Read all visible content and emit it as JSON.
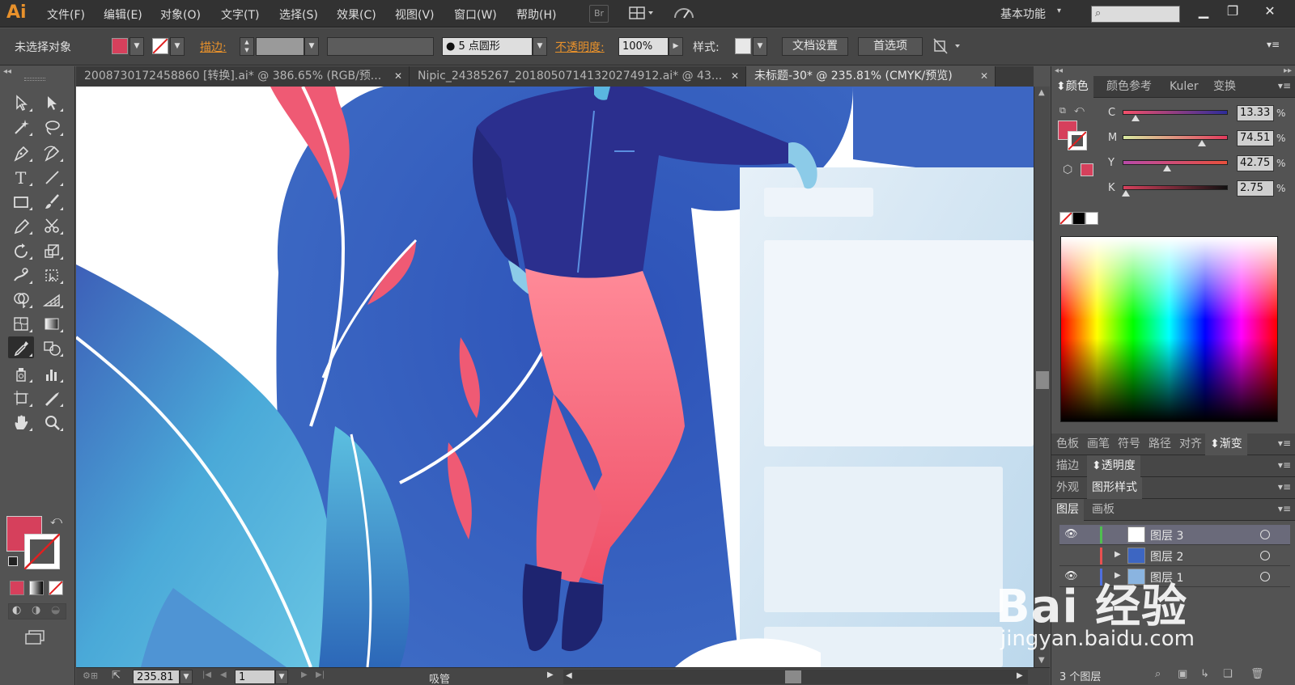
{
  "app": {
    "logo": "Ai"
  },
  "menu": [
    "文件(F)",
    "编辑(E)",
    "对象(O)",
    "文字(T)",
    "选择(S)",
    "效果(C)",
    "视图(V)",
    "窗口(W)",
    "帮助(H)"
  ],
  "menubar_icons": {
    "bridge": "Br"
  },
  "workspace": {
    "label": "基本功能",
    "search_placeholder": ""
  },
  "control_bar": {
    "selection_status": "未选择对象",
    "stroke_label": "描边",
    "brush_label": "5 点圆形",
    "opacity_label": "不透明度",
    "opacity_value": "100%",
    "style_label": "样式",
    "doc_setup_button": "文档设置",
    "preferences_button": "首选项",
    "fill_color": "#d6405c"
  },
  "document_tabs": [
    {
      "title": "2008730172458860 [转换].ai* @ 386.65% (RGB/预...",
      "active": false
    },
    {
      "title": "Nipic_24385267_20180507141320274912.ai* @ 43...",
      "active": false
    },
    {
      "title": "未标题-30* @ 235.81% (CMYK/预览)",
      "active": true
    }
  ],
  "tools": [
    "selection-tool-icon",
    "direct-selection-tool-icon",
    "magic-wand-tool-icon",
    "lasso-tool-icon",
    "pen-tool-icon",
    "curvature-pen-tool-icon",
    "type-tool-icon",
    "line-segment-tool-icon",
    "rectangle-tool-icon",
    "paintbrush-tool-icon",
    "pencil-tool-icon",
    "scissors-tool-icon",
    "rotate-tool-icon",
    "scale-tool-icon",
    "warp-tool-icon",
    "free-transform-tool-icon",
    "shape-builder-tool-icon",
    "perspective-grid-tool-icon",
    "mesh-tool-icon",
    "gradient-tool-icon",
    "eyedropper-tool-icon",
    "blend-tool-icon",
    "symbol-sprayer-tool-icon",
    "column-graph-tool-icon",
    "artboard-tool-icon",
    "slice-tool-icon",
    "hand-tool-icon",
    "zoom-tool-icon"
  ],
  "status_bar": {
    "zoom": "235.81",
    "artboard": "1",
    "current_tool": "吸管"
  },
  "panels": {
    "color_tabs": [
      "颜色",
      "颜色参考",
      "Kuler",
      "变换"
    ],
    "cmyk": [
      {
        "channel": "C",
        "value": "13.33",
        "fraction": 0.12,
        "gradient": "linear-gradient(to right,#f4506a,#2c2c9a)"
      },
      {
        "channel": "M",
        "value": "74.51",
        "fraction": 0.75,
        "gradient": "linear-gradient(to right,#d8e8a0,#e33a5c)"
      },
      {
        "channel": "Y",
        "value": "42.75",
        "fraction": 0.42,
        "gradient": "linear-gradient(to right,#b84aa8,#e8503c)"
      },
      {
        "channel": "K",
        "value": "2.75",
        "fraction": 0.03,
        "gradient": "linear-gradient(to right,#d6405c,#111111)"
      }
    ],
    "pct_sign": "%",
    "swatch_tabs": [
      "色板",
      "画笔",
      "符号",
      "路径",
      "对齐",
      "渐变"
    ],
    "stroke_tabs": [
      "描边",
      "透明度"
    ],
    "appearance_tabs": [
      "外观",
      "图形样式"
    ],
    "layer_tabs": [
      "图层",
      "画板"
    ],
    "layers": [
      {
        "name": "图层 3",
        "color": "#4fbf4f",
        "selected": true
      },
      {
        "name": "图层 2",
        "color": "#e85050",
        "selected": false
      },
      {
        "name": "图层 1",
        "color": "#4f6fdf",
        "selected": false
      }
    ],
    "layers_count": "3 个图层"
  },
  "watermark": {
    "brand": "Bai 经验",
    "url": "jingyan.baidu.com"
  }
}
